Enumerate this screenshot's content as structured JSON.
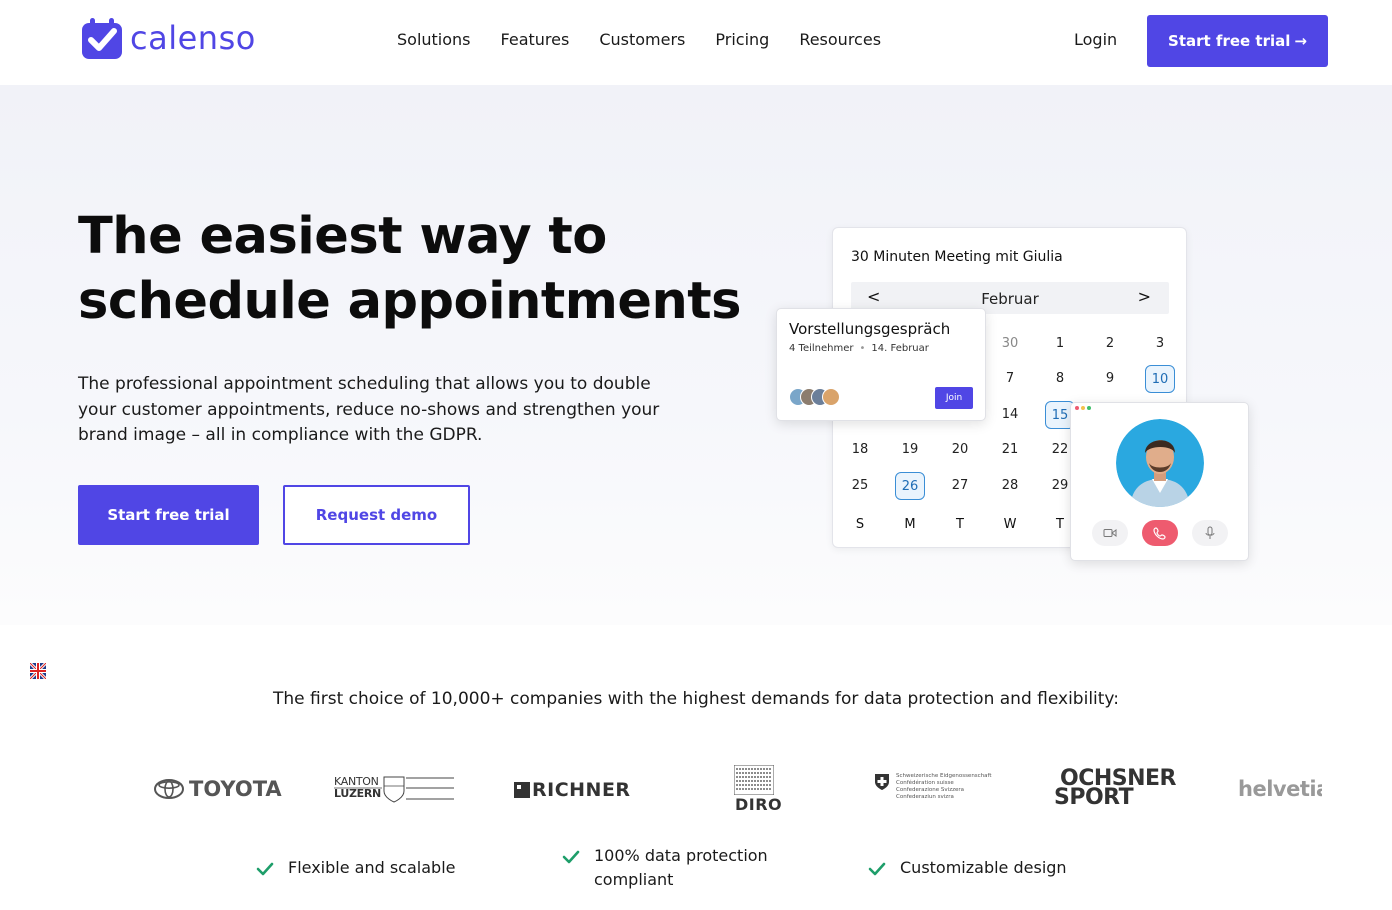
{
  "brand": {
    "name": "calenso",
    "color": "#5046e5"
  },
  "nav": {
    "items": [
      "Solutions",
      "Features",
      "Customers",
      "Pricing",
      "Resources"
    ],
    "login": "Login",
    "cta": "Start free trial",
    "cta_arrow": "→"
  },
  "hero": {
    "title_line1": "The easiest way to",
    "title_line2": "schedule appointments",
    "subtitle": "The professional appointment scheduling that allows you to double your customer appointments, reduce no-shows and strengthen your brand image – all in compliance with the GDPR.",
    "primary_button": "Start free trial",
    "secondary_button": "Request demo"
  },
  "calendar": {
    "title": "30 Minuten Meeting mit Giulia",
    "month": "Februar",
    "prev": "<",
    "next": ">",
    "rows": [
      [
        "30",
        "1",
        "2",
        "3"
      ],
      [
        "7",
        "8",
        "9",
        "10"
      ],
      [
        "14",
        "15"
      ],
      [
        "18",
        "19",
        "20",
        "21",
        "22"
      ],
      [
        "25",
        "26",
        "27",
        "28",
        "29"
      ]
    ],
    "weekdays": [
      "S",
      "M",
      "T",
      "W",
      "T"
    ],
    "selected_days": [
      "10",
      "15",
      "26"
    ]
  },
  "meeting": {
    "title": "Vorstellungsgespräch",
    "participants": "4 Teilnehmer",
    "date": "14. Februar",
    "join": "Join"
  },
  "call": {
    "icons": [
      "video-icon",
      "hangup-icon",
      "mic-icon"
    ],
    "hangup_color": "#ee5b6f"
  },
  "language": {
    "icon": "uk-flag-icon"
  },
  "trust": {
    "text": "The first choice of 10,000+ companies with the highest demands for data protection and flexibility:",
    "logos": [
      {
        "name": "toyota-logo",
        "text": "TOYOTA"
      },
      {
        "name": "kanton-luzern-logo",
        "line1": "KANTON",
        "line2": "LUZERN"
      },
      {
        "name": "richner-logo",
        "text": "RICHNER"
      },
      {
        "name": "diro-logo",
        "text": "DIRO"
      },
      {
        "name": "swiss-confederation-logo",
        "lines": [
          "Schweizerische Eidgenossenschaft",
          "Confédération suisse",
          "Confederazione Svizzera",
          "Confederaziun svizra"
        ]
      },
      {
        "name": "ochsner-sport-logo",
        "line1": "OCHSNER",
        "line2": "SPORT"
      },
      {
        "name": "helvetia-logo",
        "text": "helvetia"
      }
    ]
  },
  "features": [
    "Flexible and scalable",
    "100% data protection compliant",
    "Customizable design"
  ],
  "colors": {
    "check": "#1e9e6a",
    "accent_blue": "#3a8ed6"
  }
}
